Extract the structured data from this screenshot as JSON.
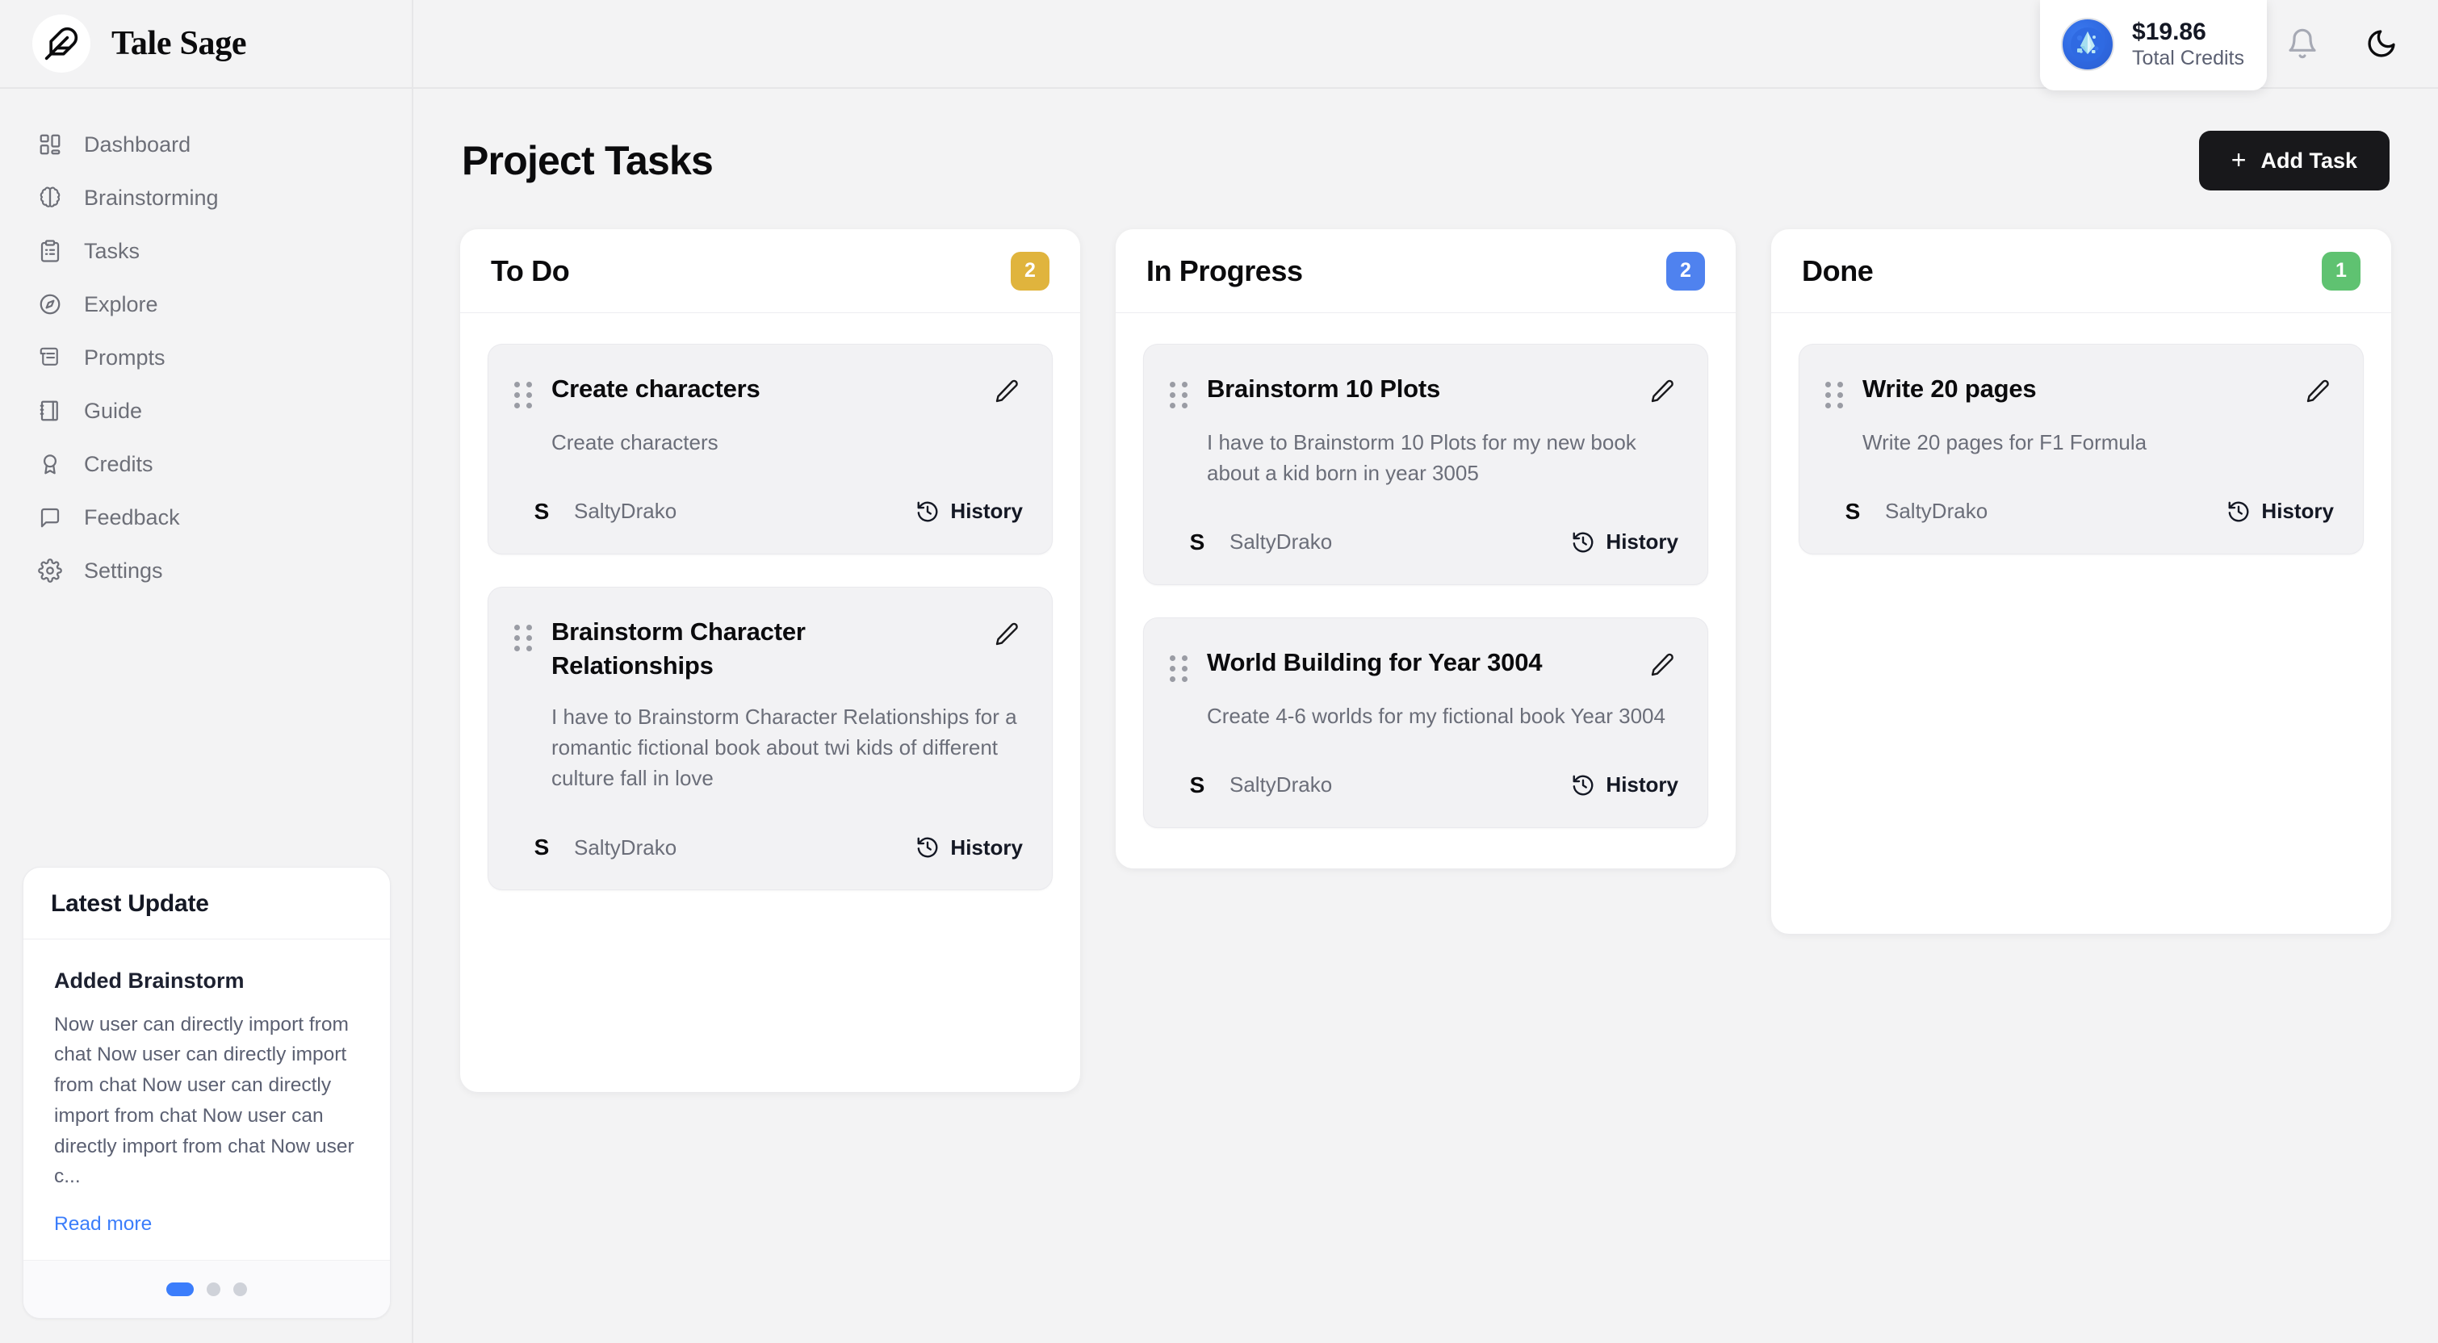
{
  "brand": {
    "name": "Tale Sage",
    "logo_icon": "feather-icon"
  },
  "sidebar": {
    "items": [
      {
        "label": "Dashboard",
        "icon": "layout-dashboard-icon"
      },
      {
        "label": "Brainstorming",
        "icon": "brain-icon"
      },
      {
        "label": "Tasks",
        "icon": "clipboard-list-icon"
      },
      {
        "label": "Explore",
        "icon": "compass-icon"
      },
      {
        "label": "Prompts",
        "icon": "scroll-text-icon"
      },
      {
        "label": "Guide",
        "icon": "notebook-icon"
      },
      {
        "label": "Credits",
        "icon": "award-icon"
      },
      {
        "label": "Feedback",
        "icon": "message-square-icon"
      },
      {
        "label": "Settings",
        "icon": "gear-icon"
      }
    ],
    "latest_update": {
      "title": "Latest Update",
      "item_title": "Added Brainstorm",
      "item_text": "Now user can directly import from chat Now user can directly import from chat Now user can directly import from chat Now user can directly import from chat Now user c...",
      "read_more": "Read more",
      "dots": 3,
      "active_dot": 0,
      "accent_color": "#3b7dfb"
    }
  },
  "topbar": {
    "credits": {
      "amount": "$19.86",
      "label": "Total Credits",
      "icon": "gem-icon"
    },
    "notifications_icon": "bell-icon",
    "theme_toggle_icon": "moon-icon"
  },
  "page": {
    "title": "Project Tasks",
    "add_task_label": "Add Task",
    "add_task_icon": "plus-icon"
  },
  "board": {
    "columns": [
      {
        "title": "To Do",
        "count": "2",
        "badge_color": "#e0b43d",
        "tasks": [
          {
            "title": "Create characters",
            "description": "Create characters",
            "user": "SaltyDrako",
            "avatar_initial": "S",
            "history_label": "History",
            "history_icon": "history-icon",
            "edit_icon": "pencil-icon",
            "drag_icon": "grip-vertical-icon"
          },
          {
            "title": "Brainstorm Character Relationships",
            "description": "I have to Brainstorm Character Relationships for a romantic fictional book about twi kids of different culture fall in love",
            "user": "SaltyDrako",
            "avatar_initial": "S",
            "history_label": "History",
            "history_icon": "history-icon",
            "edit_icon": "pencil-icon",
            "drag_icon": "grip-vertical-icon"
          }
        ]
      },
      {
        "title": "In Progress",
        "count": "2",
        "badge_color": "#4f82ef",
        "tasks": [
          {
            "title": "Brainstorm 10 Plots",
            "description": "I have to Brainstorm 10 Plots for my new book about a kid born in year 3005",
            "user": "SaltyDrako",
            "avatar_initial": "S",
            "history_label": "History",
            "history_icon": "history-icon",
            "edit_icon": "pencil-icon",
            "drag_icon": "grip-vertical-icon"
          },
          {
            "title": "World Building for Year 3004",
            "description": "Create 4-6 worlds for my fictional book Year 3004",
            "user": "SaltyDrako",
            "avatar_initial": "S",
            "history_label": "History",
            "history_icon": "history-icon",
            "edit_icon": "pencil-icon",
            "drag_icon": "grip-vertical-icon"
          }
        ]
      },
      {
        "title": "Done",
        "count": "1",
        "badge_color": "#5fc271",
        "tasks": [
          {
            "title": "Write 20 pages",
            "description": "Write 20 pages for F1 Formula",
            "user": "SaltyDrako",
            "avatar_initial": "S",
            "history_label": "History",
            "history_icon": "history-icon",
            "edit_icon": "pencil-icon",
            "drag_icon": "grip-vertical-icon"
          }
        ]
      }
    ]
  }
}
